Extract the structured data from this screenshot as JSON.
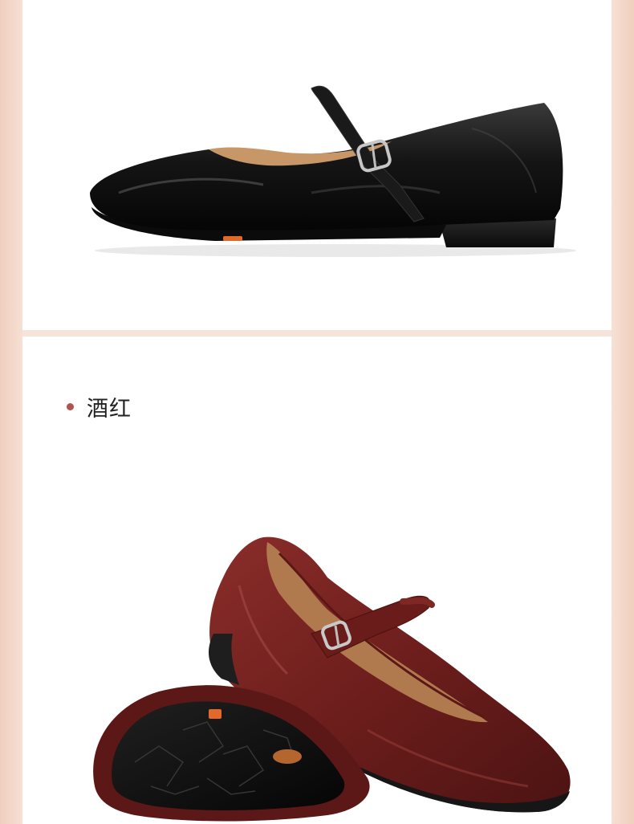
{
  "colors": {
    "page_side": "#f6e1d6",
    "panel": "#ffffff",
    "bullet": "#b3534e",
    "black_leather": "#111111",
    "wine_leather": "#6d1e1c"
  },
  "variants": [
    {
      "label": "",
      "image": "black-mary-jane-flat"
    },
    {
      "label": "酒红",
      "image": "wine-red-mary-jane-flat-pair"
    }
  ]
}
